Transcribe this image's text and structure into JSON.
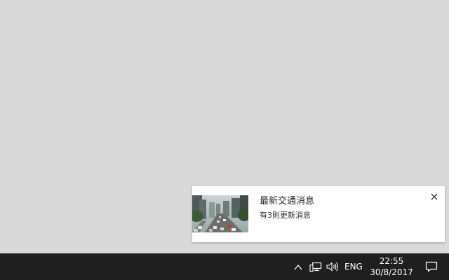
{
  "notification": {
    "title": "最新交通消息",
    "body": "有3則更新消息",
    "thumbnail_icon": "traffic-photo",
    "close_icon": "close-icon"
  },
  "taskbar": {
    "background": "#1f1f1f",
    "tray": {
      "chevron_icon": "chevron-up-icon",
      "network_icon": "network-icon",
      "volume_icon": "volume-icon",
      "language": "ENG"
    },
    "clock": {
      "time": "22:55",
      "date": "30/8/2017"
    },
    "action_center_icon": "action-center-icon"
  },
  "desktop": {
    "background": "#d9d9d9"
  }
}
